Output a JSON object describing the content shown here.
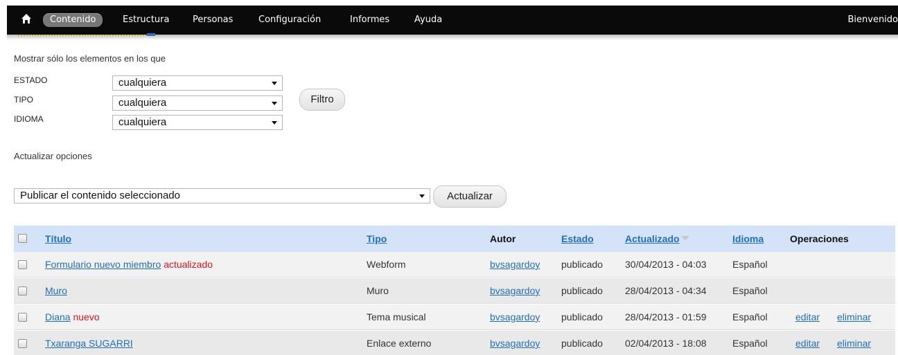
{
  "toolbar": {
    "home_icon": "home-icon",
    "items": [
      "Contenido",
      "Estructura",
      "Personas",
      "Configuración",
      "Informes",
      "Ayuda"
    ],
    "active_item": "Contenido",
    "welcome": "Bienvenido"
  },
  "filters": {
    "title": "Mostrar sólo los elementos en los que",
    "estado_label": "ESTADO",
    "estado_value": "cualquiera",
    "tipo_label": "TIPO",
    "tipo_value": "cualquiera",
    "idioma_label": "IDIOMA",
    "idioma_value": "cualquiera",
    "filter_button": "Filtro"
  },
  "update": {
    "label": "Actualizar opciones",
    "action_value": "Publicar el contenido seleccionado",
    "update_button": "Actualizar"
  },
  "table": {
    "headers": {
      "title": "Título",
      "type": "Tipo",
      "author": "Autor",
      "status": "Estado",
      "updated": "Actualizado",
      "language": "Idioma",
      "operations": "Operaciones"
    },
    "rows": [
      {
        "title": "Formulario nuevo miembro",
        "flag": "actualizado",
        "type": "Webform",
        "author": "bvsagardoy",
        "status": "publicado",
        "updated": "30/04/2013 - 04:03",
        "language": "Español",
        "edit": "",
        "delete": ""
      },
      {
        "title": "Muro",
        "flag": "",
        "type": "Muro",
        "author": "bvsagardoy",
        "status": "publicado",
        "updated": "28/04/2013 - 04:34",
        "language": "Español",
        "edit": "",
        "delete": ""
      },
      {
        "title": "Diana",
        "flag": "nuevo",
        "type": "Tema musical",
        "author": "bvsagardoy",
        "status": "publicado",
        "updated": "28/04/2013 - 01:59",
        "language": "Español",
        "edit": "editar",
        "delete": "eliminar"
      },
      {
        "title": "Txaranga SUGARRI",
        "flag": "",
        "type": "Enlace externo",
        "author": "bvsagardoy",
        "status": "publicado",
        "updated": "02/04/2013 - 18:08",
        "language": "Español",
        "edit": "editar",
        "delete": "eliminar"
      }
    ]
  },
  "colors": {
    "toolbar_bg": "#0a0a0a",
    "header_bg": "#d5e3f9",
    "link": "#1f6fbd",
    "flag": "#e0141e"
  }
}
